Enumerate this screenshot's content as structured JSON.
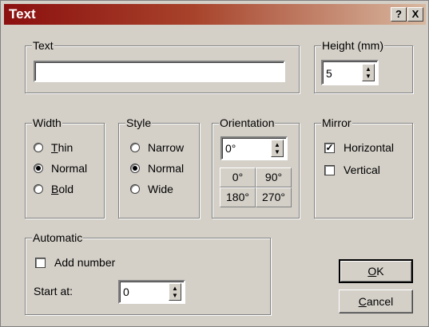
{
  "window": {
    "title": "Text",
    "help_button": "?",
    "close_button": "X"
  },
  "text_group": {
    "legend": "Text",
    "value": ""
  },
  "height_group": {
    "legend": "Height (mm)",
    "value": "5"
  },
  "width_group": {
    "legend": "Width",
    "options": [
      {
        "label": "Thin",
        "selected": false
      },
      {
        "label": "Normal",
        "selected": true
      },
      {
        "label": "Bold",
        "selected": false
      }
    ]
  },
  "style_group": {
    "legend": "Style",
    "options": [
      {
        "label": "Narrow",
        "selected": false
      },
      {
        "label": "Normal",
        "selected": true
      },
      {
        "label": "Wide",
        "selected": false
      }
    ]
  },
  "orientation_group": {
    "legend": "Orientation",
    "value": "0°",
    "buttons": [
      "0°",
      "90°",
      "180°",
      "270°"
    ]
  },
  "mirror_group": {
    "legend": "Mirror",
    "horizontal": {
      "label": "Horizontal",
      "checked": true
    },
    "vertical": {
      "label": "Vertical",
      "checked": false
    }
  },
  "automatic_group": {
    "legend": "Automatic",
    "add_number": {
      "label": "Add number",
      "checked": false
    },
    "start_at_label": "Start at:",
    "start_at_value": "0"
  },
  "buttons": {
    "ok": "OK",
    "cancel": "Cancel"
  },
  "colors": {
    "titlebar_start": "#8b0f0f",
    "titlebar_end": "#d8b8a0",
    "face": "#d4d0c8"
  }
}
